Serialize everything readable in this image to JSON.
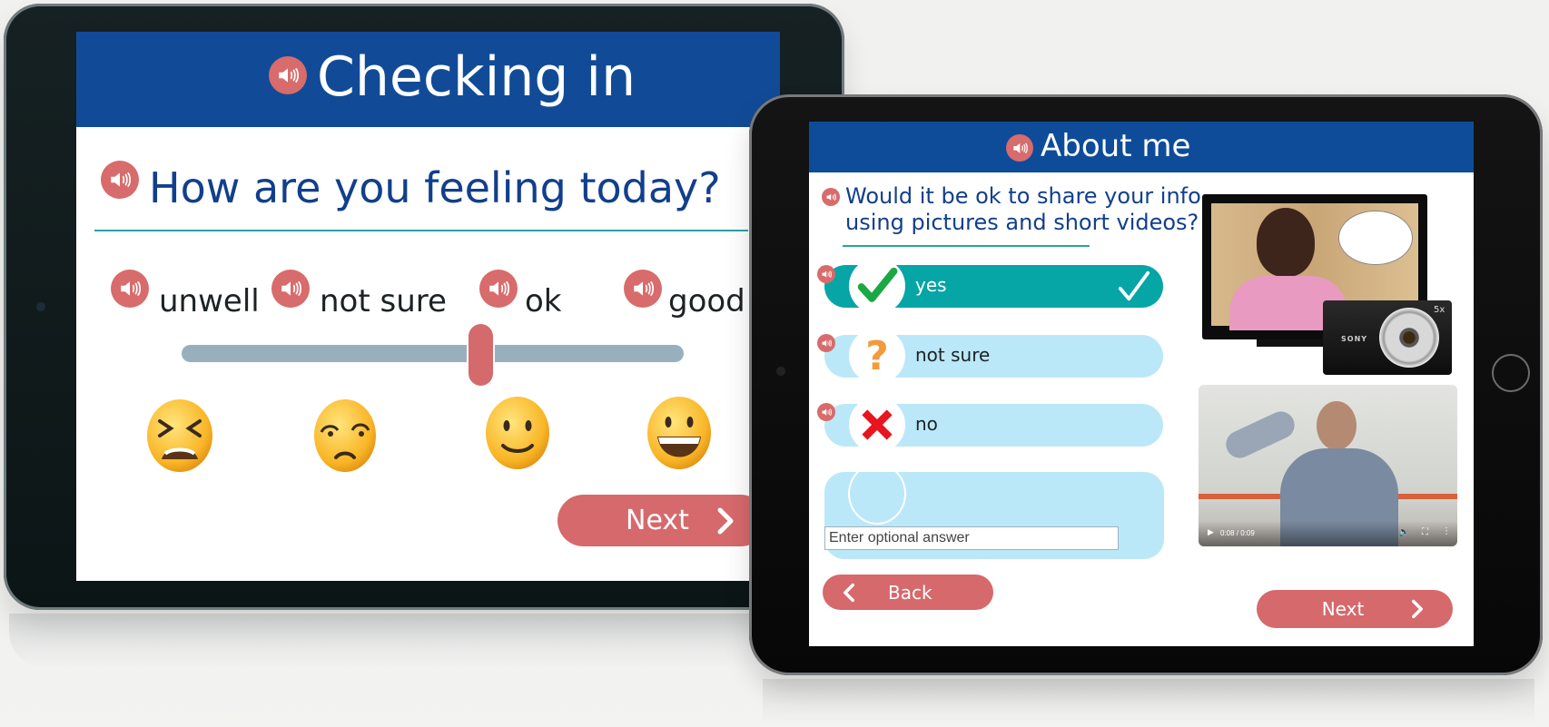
{
  "colors": {
    "header_blue": "#114b97",
    "accent_red": "#d6696c",
    "teal_selected": "#06a5a6",
    "option_light": "#bbe8f8",
    "slider_track": "#98b0bd",
    "question_blue": "#123f8c"
  },
  "left_tablet": {
    "header": {
      "title": "Checking in",
      "icon": "speaker-icon"
    },
    "question": {
      "text": "How are you feeling today?",
      "icon": "speaker-icon"
    },
    "scale_options": [
      {
        "label": "unwell",
        "emoji": "tired-face"
      },
      {
        "label": "not sure",
        "emoji": "unamused-face"
      },
      {
        "label": "ok",
        "emoji": "slightly-smiling-face"
      },
      {
        "label": "good",
        "emoji": "grinning-face"
      }
    ],
    "slider": {
      "selected": "ok",
      "position_fraction": 0.6
    },
    "next_button": {
      "label": "Next",
      "icon": "chevron-right-icon"
    }
  },
  "right_tablet": {
    "header": {
      "title": "About me",
      "icon": "speaker-icon"
    },
    "question": {
      "line1": "Would it be ok to share your info",
      "line2": "using pictures and short videos?",
      "icon": "speaker-icon"
    },
    "options": [
      {
        "label": "yes",
        "icon": "green-check-icon",
        "selected": true
      },
      {
        "label": "not sure",
        "icon": "orange-question-icon",
        "selected": false
      },
      {
        "label": "no",
        "icon": "red-cross-icon",
        "selected": false
      }
    ],
    "optional_answer": {
      "value": "",
      "placeholder": "Enter optional answer"
    },
    "media": {
      "image": {
        "description": "Woman on TV screen with speech bubble and Sony camera",
        "camera_brand": "SONY",
        "camera_zoom": "5x"
      },
      "video": {
        "time": "0:08 / 0:09"
      }
    },
    "back_button": {
      "label": "Back",
      "icon": "chevron-left-icon"
    },
    "next_button": {
      "label": "Next",
      "icon": "chevron-right-icon"
    }
  }
}
